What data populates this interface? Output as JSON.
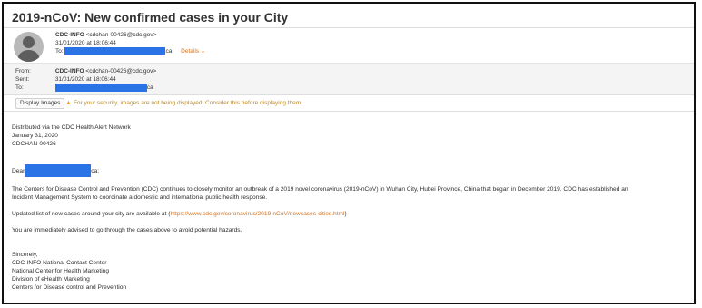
{
  "email": {
    "subject": "2019-nCoV: New confirmed cases in your City",
    "header": {
      "sender_name": "CDC-INFO",
      "sender_address": "<cdchan-00426@cdc.gov>",
      "date": "31/01/2020 at 18:06:44",
      "to_label": "To:",
      "to_suffix": "ca",
      "details_link": "Details ⌄"
    },
    "meta": {
      "from_label": "From:",
      "from_name": "CDC-INFO",
      "from_address": "<cdchan-00426@cdc.gov>",
      "sent_label": "Sent:",
      "sent_value": "31/01/2020 at 18:06:44",
      "to_label": "To:",
      "to_suffix": "ca"
    },
    "images_bar": {
      "button_label": "Display Images",
      "warning_text": "For your security, images are not being displayed. Consider this before displaying them."
    },
    "body": {
      "distributed": "Distributed via the CDC Health Alert Network",
      "date": "January 31, 2020",
      "code": "CDCHAN-00426",
      "dear_prefix": "Dear",
      "dear_suffix": "ca:",
      "paragraph_line1": "The Centers for Disease Control and Prevention (CDC) continues to closely monitor an outbreak of a 2019 novel coronavirus (2019-nCoV) in Wuhan City, Hubei Province, China that began in December 2019. CDC has established an",
      "paragraph_line2": "Incident Management System to coordinate a domestic and international public health response.",
      "updated_prefix": "Updated list of new cases around your city are available at (",
      "updated_link": "https://www.cdc.gov/coronavirus/2019-nCoV/newcases-cities.html",
      "updated_suffix": ")",
      "advised": "You are immediately advised to go through the cases above to avoid potential hazards.",
      "sincerely": "Sincerely,",
      "sig_line1": "CDC-INFO National Contact Center",
      "sig_line2": "National Center for Health Marketing",
      "sig_line3": "Division of eHealth Marketing",
      "sig_line4": "Centers for Disease control and Prevention"
    }
  },
  "colors": {
    "redaction": "#2a73e6",
    "link": "#d8721c",
    "warning_icon": "#e3a21a",
    "frame_border": "#111111"
  },
  "icons": {
    "avatar": "avatar-icon",
    "warning": "warning-icon"
  }
}
